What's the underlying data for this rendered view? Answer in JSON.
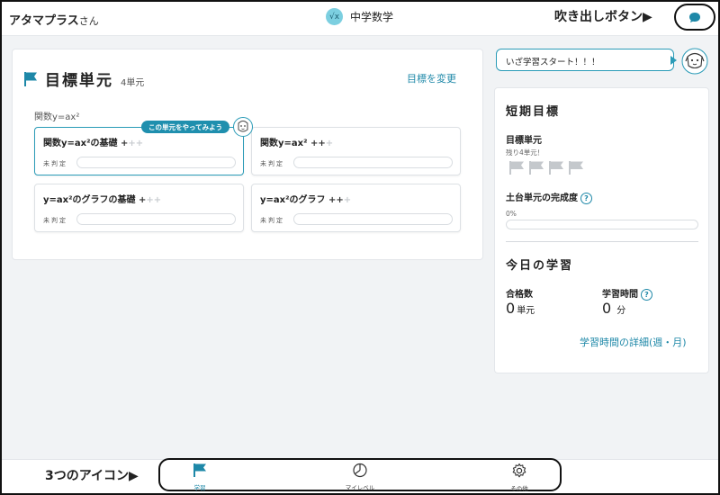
{
  "header": {
    "user_name": "アタマプラス",
    "user_suffix": "さん",
    "subject_badge": "√x",
    "subject": "中学数学",
    "chat_callout": "吹き出しボタン▶",
    "chat_icon": "speech-bubble-icon"
  },
  "goal": {
    "title": "目標単元",
    "count": "4単元",
    "change_link": "目標を変更",
    "group_label": "関数y=ax²",
    "try_bubble": "この単元をやってみよう",
    "units": [
      {
        "name": "関数y=ax²の基礎",
        "plus_on": "+",
        "plus_off": "++",
        "status": "未判定"
      },
      {
        "name": "関数y=ax²",
        "plus_on": "++",
        "plus_off": "+",
        "status": "未判定"
      },
      {
        "name": "y=ax²のグラフの基礎",
        "plus_on": "+",
        "plus_off": "++",
        "status": "未判定"
      },
      {
        "name": "y=ax²のグラフ",
        "plus_on": "++",
        "plus_off": "+",
        "status": "未判定"
      }
    ]
  },
  "speech": {
    "text": "いざ学習スタート！！！"
  },
  "short_term": {
    "title": "短期目標",
    "target_label": "目標単元",
    "remaining": "残り4単元！",
    "flag_count": 4,
    "base_label": "土台単元の完成度",
    "help": "?",
    "progress_text": "0%",
    "progress": 0
  },
  "today": {
    "title": "今日の学習",
    "passed_label": "合格数",
    "passed_value": "0",
    "passed_unit": "単元",
    "time_label": "学習時間",
    "time_value": "0",
    "time_unit": "分",
    "detail_link": "学習時間の詳細(週・月)"
  },
  "bottom_nav": {
    "callout": "3つのアイコン▶",
    "items": [
      {
        "label": "学習",
        "icon": "flag-icon",
        "active": true
      },
      {
        "label": "マイレベル",
        "icon": "pie-chart-icon",
        "active": false
      },
      {
        "label": "その他",
        "icon": "gear-icon",
        "active": false
      }
    ]
  },
  "colors": {
    "accent": "#1e88a8",
    "flag_gray": "#c4c8cc",
    "background": "#f1f3f5"
  }
}
